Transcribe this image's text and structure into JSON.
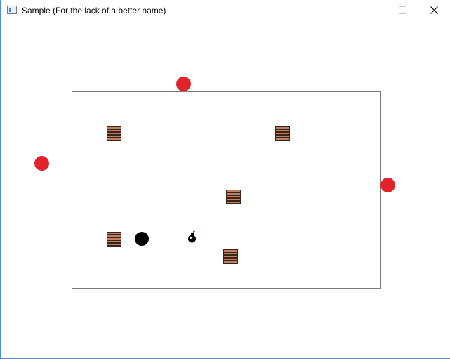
{
  "window": {
    "title": "Sample (For the lack of a better name)",
    "app_icon": "window-app-icon",
    "controls": {
      "minimize_icon": "minimize-icon",
      "maximize_icon": "maximize-icon",
      "close_icon": "close-icon"
    }
  },
  "game": {
    "colors": {
      "enemy": "#e3232b",
      "player": "#000000",
      "crate_fill": "#c08068",
      "crate_stripe": "#3a2418",
      "arena_border": "#7a7a7a",
      "background": "#ffffff"
    },
    "sprites": {
      "crate": "wooden-crate-sprite",
      "enemy": "red-ball-sprite",
      "player": "black-ball-sprite",
      "bomb": "bomb-sprite"
    },
    "crate_count": 5,
    "enemy_count": 3
  }
}
